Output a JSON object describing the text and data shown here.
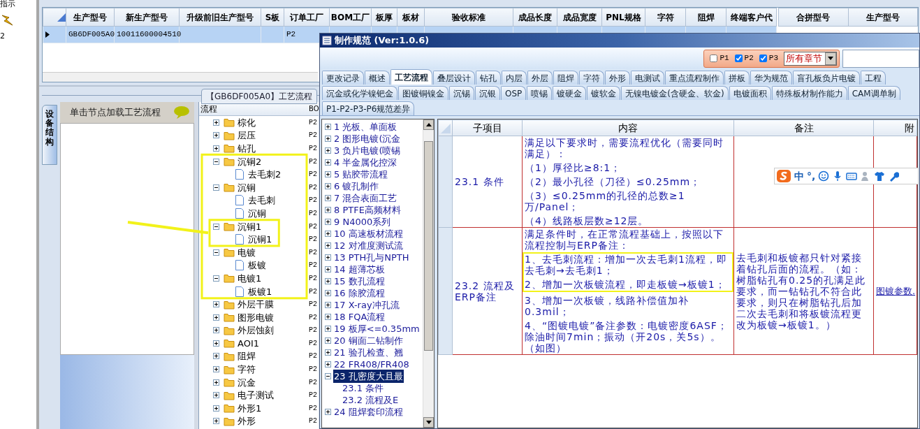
{
  "left_strip": {
    "labels": [
      "指示",
      "2"
    ]
  },
  "main_table": {
    "columns": [
      "生产型号",
      "新生产型号",
      "升级前旧生产型号",
      "S板",
      "订单工厂",
      "BOM工厂",
      "板厚",
      "板材",
      "验收标准",
      "成品长度",
      "成品宽度",
      "PNL规格",
      "字符",
      "阻焊",
      "终端客户代"
    ],
    "rows": [
      {
        "selected": true,
        "cells": [
          "GB6DF005A0",
          "10011600004510",
          null,
          null,
          "P2"
        ]
      }
    ]
  },
  "merge_table": {
    "columns": [
      "合拼型号",
      "生产型号"
    ]
  },
  "process_panel": {
    "title": "【GB6DF005A0】工艺流程",
    "side_tab": "设备结构",
    "hint": "单击节点加载工艺流程",
    "tree_columns": [
      "流程",
      "BO"
    ],
    "tree": [
      {
        "label": "棕化",
        "value": "P2",
        "expanded": false
      },
      {
        "label": "层压",
        "value": "P2",
        "expanded": false
      },
      {
        "label": "钻孔",
        "value": "P2",
        "expanded": false
      },
      {
        "label": "沉铜2",
        "value": "P2",
        "expanded": true,
        "children": [
          {
            "label": "去毛刺2",
            "value": "P2"
          }
        ]
      },
      {
        "label": "沉铜",
        "value": "P2",
        "expanded": true,
        "children": [
          {
            "label": "去毛刺",
            "value": "P2"
          },
          {
            "label": "沉铜",
            "value": "P2"
          }
        ]
      },
      {
        "label": "沉铜1",
        "value": "P2",
        "expanded": true,
        "children": [
          {
            "label": "沉铜1",
            "value": "P2"
          }
        ]
      },
      {
        "label": "电镀",
        "value": "P2",
        "expanded": true,
        "children": [
          {
            "label": "板镀",
            "value": "P2"
          }
        ]
      },
      {
        "label": "电镀1",
        "value": "P2",
        "expanded": true,
        "children": [
          {
            "label": "板镀1",
            "value": "P2"
          }
        ]
      },
      {
        "label": "外层干膜",
        "value": "P2",
        "expanded": false
      },
      {
        "label": "图形电镀",
        "value": "P2",
        "expanded": false
      },
      {
        "label": "外层蚀刻",
        "value": "P2",
        "expanded": false
      },
      {
        "label": "AOI1",
        "value": "P2",
        "expanded": false
      },
      {
        "label": "阻焊",
        "value": "P2",
        "expanded": false
      },
      {
        "label": "字符",
        "value": "P2",
        "expanded": false
      },
      {
        "label": "沉金",
        "value": "P2",
        "expanded": false
      },
      {
        "label": "电子测试",
        "value": "P2",
        "expanded": false
      },
      {
        "label": "外形1",
        "value": "P2",
        "expanded": false
      },
      {
        "label": "外形",
        "value": "P2",
        "expanded": false
      }
    ]
  },
  "spec_window": {
    "title": "制作规范 (Ver:1.0.6)",
    "filters": [
      {
        "label": "P1",
        "checked": false
      },
      {
        "label": "P2",
        "checked": true
      },
      {
        "label": "P3",
        "checked": true
      }
    ],
    "chapter_select": "所有章节",
    "tab_rows": [
      [
        {
          "label": "更改记录",
          "selected": false
        },
        {
          "label": "概述",
          "selected": false
        },
        {
          "label": "工艺流程",
          "selected": true
        },
        {
          "label": "叠层设计",
          "selected": false
        },
        {
          "label": "钻孔",
          "selected": false
        },
        {
          "label": "内层",
          "selected": false
        },
        {
          "label": "外层",
          "selected": false
        },
        {
          "label": "阻焊",
          "selected": false
        },
        {
          "label": "字符",
          "selected": false
        },
        {
          "label": "外形",
          "selected": false
        },
        {
          "label": "电测试",
          "selected": false
        },
        {
          "label": "重点流程制作",
          "selected": false
        },
        {
          "label": "拼板",
          "selected": false
        },
        {
          "label": "华为规范",
          "selected": false
        },
        {
          "label": "盲孔板负片电镀",
          "selected": false
        },
        {
          "label": "工程",
          "selected": false
        }
      ],
      [
        {
          "label": "沉金或化学镍钯金",
          "selected": false
        },
        {
          "label": "图镀铜镍金",
          "selected": false
        },
        {
          "label": "沉锡",
          "selected": false
        },
        {
          "label": "沉银",
          "selected": false
        },
        {
          "label": "OSP",
          "selected": false
        },
        {
          "label": "喷锡",
          "selected": false
        },
        {
          "label": "镀硬金",
          "selected": false
        },
        {
          "label": "镀软金",
          "selected": false
        },
        {
          "label": "无镍电镀金(含硬金、软金)",
          "selected": false
        },
        {
          "label": "电镀面积",
          "selected": false
        },
        {
          "label": "特殊板材制作能力",
          "selected": false
        },
        {
          "label": "CAM调单制",
          "selected": false
        }
      ],
      [
        {
          "label": "P1-P2-P3-P6规范差异",
          "selected": false
        }
      ]
    ],
    "tree": [
      {
        "label": "1 光板、单面板",
        "expanded": false,
        "selected": false
      },
      {
        "label": "2 图形电镀(沉金",
        "expanded": false,
        "selected": false
      },
      {
        "label": "3 负片电镀(喷锡",
        "expanded": false,
        "selected": false
      },
      {
        "label": "4 半金属化控深",
        "expanded": false,
        "selected": false
      },
      {
        "label": "5 贴胶带流程",
        "expanded": false,
        "selected": false
      },
      {
        "label": "6 镀孔制作",
        "expanded": false,
        "selected": false
      },
      {
        "label": "7 混合表面工艺",
        "expanded": false,
        "selected": false
      },
      {
        "label": "8 PTFE高频材料",
        "expanded": false,
        "selected": false
      },
      {
        "label": "9 N4000系列",
        "expanded": false,
        "selected": false
      },
      {
        "label": "10 高速板材流程",
        "expanded": false,
        "selected": false
      },
      {
        "label": "12 对准度测试流",
        "expanded": false,
        "selected": false
      },
      {
        "label": "13 PTH孔与NPTH",
        "expanded": false,
        "selected": false
      },
      {
        "label": "14 超薄芯板",
        "expanded": false,
        "selected": false
      },
      {
        "label": "15 数孔流程",
        "expanded": false,
        "selected": false
      },
      {
        "label": "16 除胶流程",
        "expanded": false,
        "selected": false
      },
      {
        "label": "17 X-ray冲孔流",
        "expanded": false,
        "selected": false
      },
      {
        "label": "18 FQA流程",
        "expanded": false,
        "selected": false
      },
      {
        "label": "19 板厚<=0.35mm",
        "expanded": false,
        "selected": false
      },
      {
        "label": "20 铜面二钻制作",
        "expanded": false,
        "selected": false
      },
      {
        "label": "21 验孔检查、翘",
        "expanded": false,
        "selected": false
      },
      {
        "label": "22 FR408/FR408",
        "expanded": false,
        "selected": false
      },
      {
        "label": "23 孔密度大且最",
        "expanded": true,
        "selected": true,
        "children": [
          {
            "label": "23.1 条件",
            "selected": false
          },
          {
            "label": "23.2 流程及E",
            "selected": false
          }
        ]
      },
      {
        "label": "24 阻焊套印流程",
        "expanded": false,
        "selected": false
      }
    ],
    "table": {
      "columns": [
        "子项目",
        "内容",
        "备注",
        "附"
      ],
      "rows": [
        {
          "sub_item": "23.1 条件",
          "content": [
            "满足以下要求时，需要流程优化（需要同时满足）：",
            "（1）厚径比≥8:1；",
            "（2）最小孔径（刀径）≤0.25mm；",
            "（3）≤0.25mm的孔径的总数≥1万/Panel；",
            "（4）线路板层数≥12层。"
          ]
        },
        {
          "sub_item": "23.2 流程及ERP备注",
          "content": [
            "满足条件时，在正常流程基础上，按照以下流程控制与ERP备注：",
            "1、去毛刺流程：增加一次去毛刺1流程，即去毛刺→去毛刺1；",
            "2、增加一次板镀流程，即走板镀→板镀1；",
            "3、增加一次板镀，线路补偿值加补0.3mil；",
            "4、“图镀电镀”备注参数：电镀密度6ASF；除油时间7min；振动（开20s，关5s）。（如图）"
          ],
          "note": "去毛刺和板镀都只针对紧接着钻孔后面的流程。（如：树脂钻孔有0.25的孔满足此要求，而一钻钻孔不符合此要求，则只在树脂钻孔后加二次去毛刺和将板镀流程更改为板镀→板镀1。）",
          "attachment": "图镀参数."
        }
      ]
    }
  },
  "ime_toolbar": {
    "labels": [
      "中",
      "°,"
    ]
  }
}
